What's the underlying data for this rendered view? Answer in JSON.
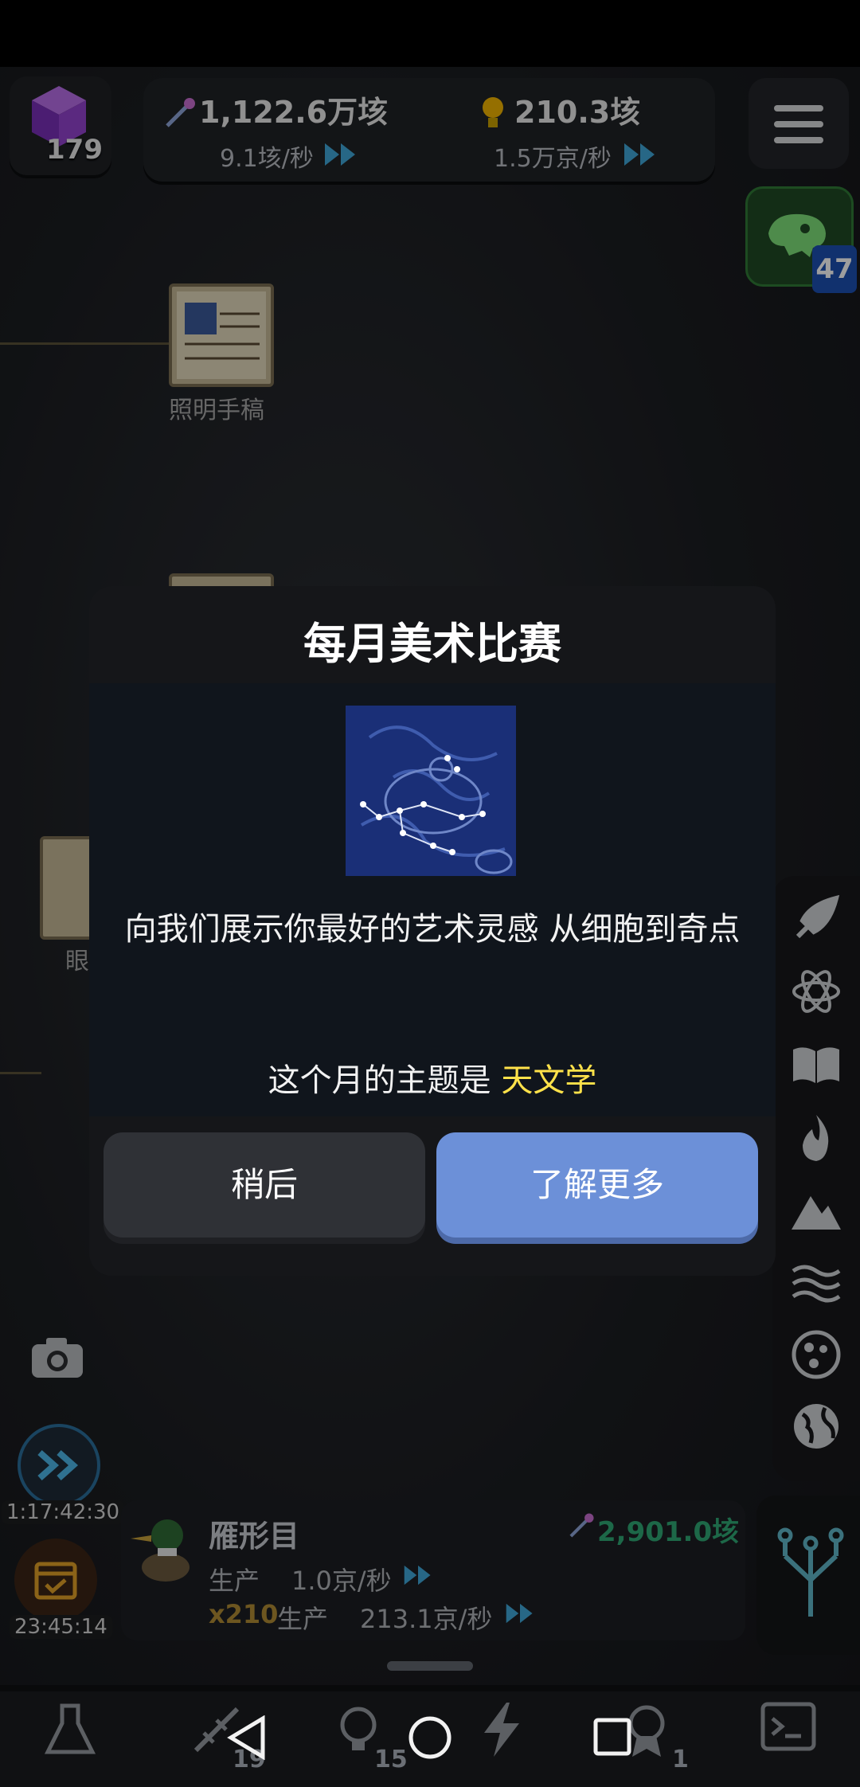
{
  "hud": {
    "level": "179",
    "primary_amount": "1,122.6万垓",
    "primary_rate": "9.1垓/秒",
    "secondary_amount": "210.3垓",
    "secondary_rate": "1.5万京/秒",
    "dino_badge": "47"
  },
  "tree": {
    "node1_label": "照明手稿",
    "node3_label_partial": "眼"
  },
  "dialog": {
    "title": "每月美术比赛",
    "description": "向我们展示你最好的艺术灵感 从细胞到奇点",
    "theme_prefix": "这个月的主题是 ",
    "theme_value": "天文学",
    "later_label": "稍后",
    "learn_more_label": "了解更多",
    "theme_color": "#ffe24a"
  },
  "timers": {
    "fast_forward": "1:17:42:30",
    "calendar": "23:45:14"
  },
  "species": {
    "name": "雁形目",
    "cost": "2,901.0垓",
    "production_label": "生产",
    "production_value": "1.0京/秒",
    "multiplier": "x210",
    "total_label": "生产",
    "total_value": "213.1京/秒"
  },
  "bottom_tabs": {
    "dna_count": "19",
    "idea_count": "15",
    "award_count": "1"
  },
  "side_rail_icons": [
    "rocket-icon",
    "atom-icon",
    "book-icon",
    "fire-icon",
    "mountain-icon",
    "waves-icon",
    "cell-icon",
    "globe-icon"
  ]
}
